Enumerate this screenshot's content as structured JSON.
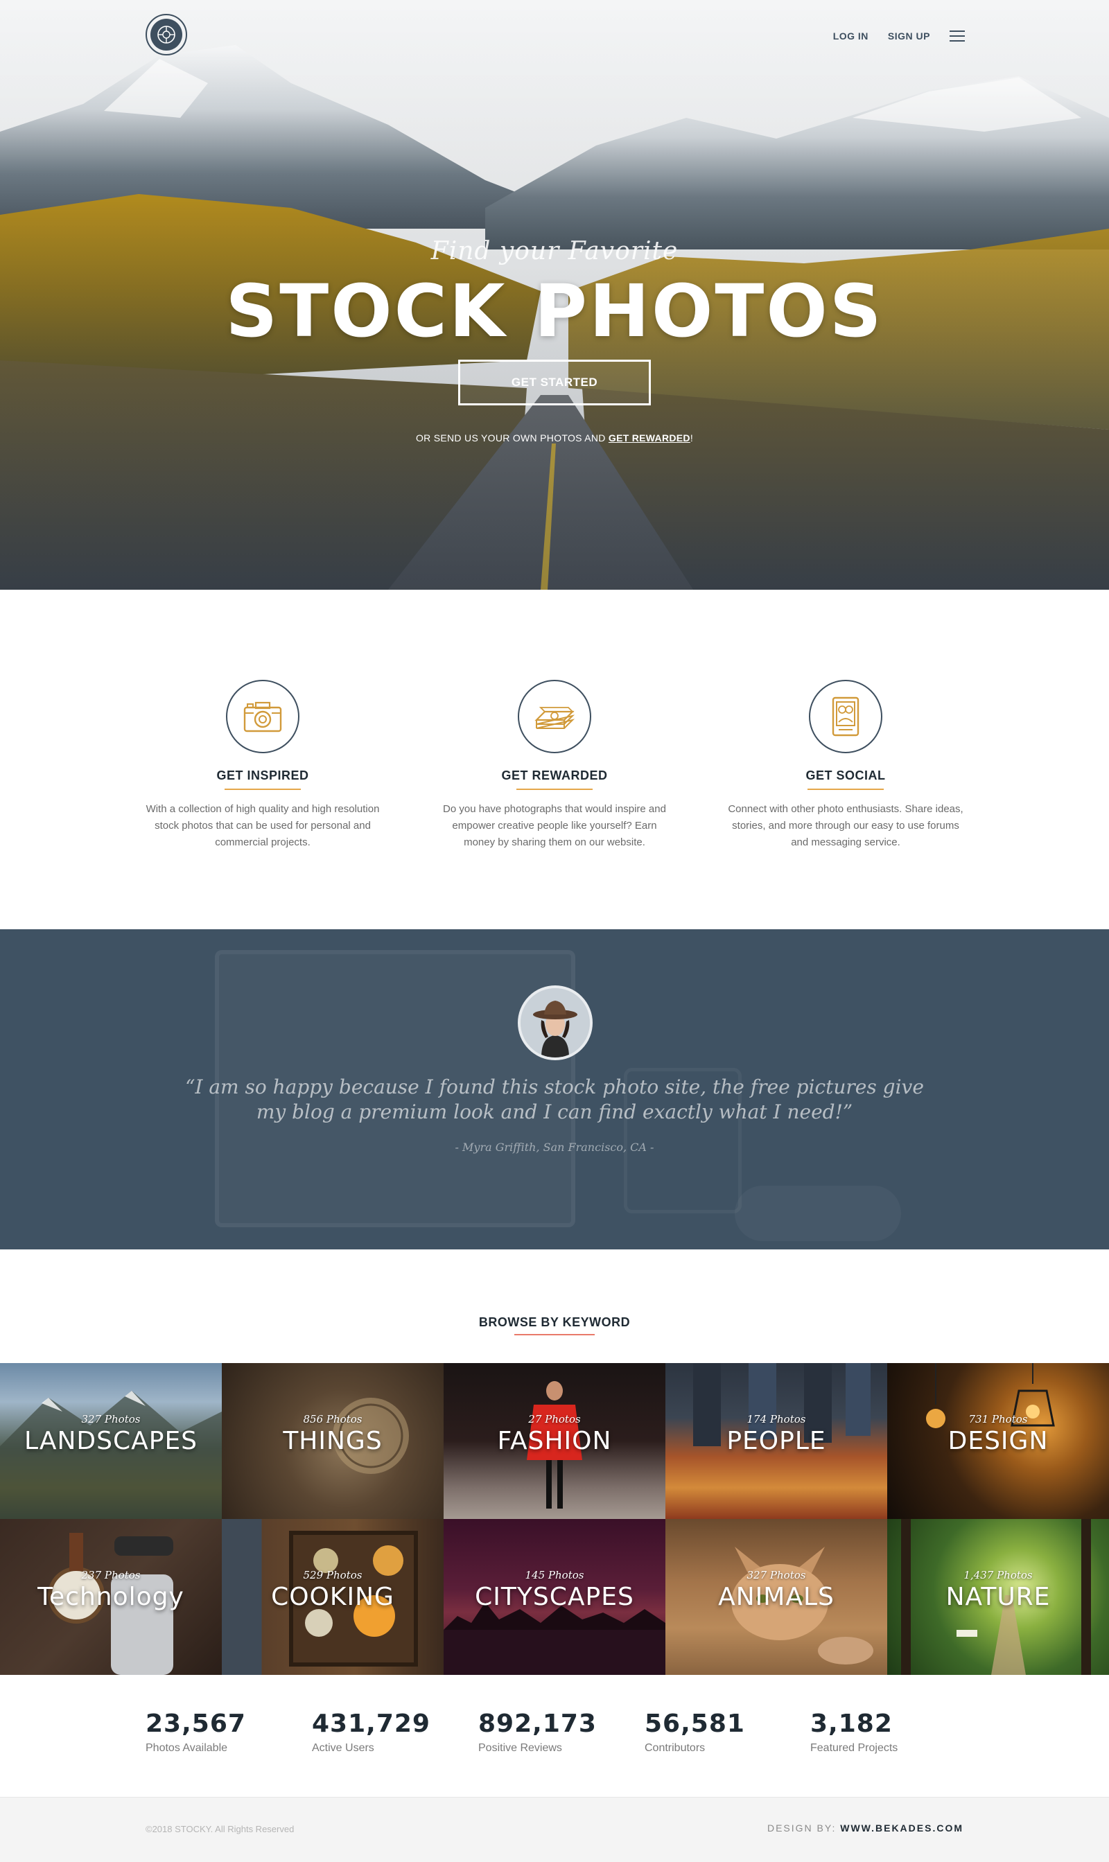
{
  "nav": {
    "login": "LOG IN",
    "signup": "SIGN UP"
  },
  "hero": {
    "subtitle": "Find your Favorite",
    "title": "STOCK PHOTOS",
    "cta": "GET STARTED",
    "note_prefix": "OR SEND US YOUR OWN PHOTOS AND ",
    "note_link": "GET REWARDED",
    "note_suffix": "!"
  },
  "features": [
    {
      "title": "GET INSPIRED",
      "text": "With a collection of high quality and high resolution stock photos that can be used for personal and commercial projects.",
      "icon": "camera-icon"
    },
    {
      "title": "GET REWARDED",
      "text": "Do you have photographs that would inspire and empower creative people like yourself? Earn money by sharing them on our website.",
      "icon": "money-stack-icon"
    },
    {
      "title": "GET SOCIAL",
      "text": "Connect with other photo enthusiasts. Share ideas, stories, and more through our easy to use forums and messaging service.",
      "icon": "social-device-icon"
    }
  ],
  "testimonial": {
    "quote": "“I am so happy because I found this stock photo site,  the free pictures give my blog a premium look and I can find exactly what I need!”",
    "author": "- Myra Griffith, San Francisco, CA -"
  },
  "browse": {
    "heading": "BROWSE BY KEYWORD",
    "tiles": [
      {
        "count": "327 Photos",
        "label": "LANDSCAPES"
      },
      {
        "count": "856 Photos",
        "label": "THINGS"
      },
      {
        "count": "27 Photos",
        "label": "FASHION"
      },
      {
        "count": "174 Photos",
        "label": "PEOPLE"
      },
      {
        "count": "731 Photos",
        "label": "DESIGN"
      },
      {
        "count": "237 Photos",
        "label": "Technology"
      },
      {
        "count": "529 Photos",
        "label": "COOKING"
      },
      {
        "count": "145 Photos",
        "label": "CITYSCAPES"
      },
      {
        "count": "327 Photos",
        "label": "ANIMALS"
      },
      {
        "count": "1,437 Photos",
        "label": "NATURE"
      }
    ]
  },
  "stats": [
    {
      "value": "23,567",
      "label": "Photos Available"
    },
    {
      "value": "431,729",
      "label": "Active Users"
    },
    {
      "value": "892,173",
      "label": "Positive Reviews"
    },
    {
      "value": "56,581",
      "label": "Contributors"
    },
    {
      "value": "3,182",
      "label": "Featured Projects"
    }
  ],
  "footer": {
    "copyright": "©2018 STOCKY. All Rights Reserved",
    "credit_prefix": "DESIGN BY: ",
    "credit_link": "WWW.BEKADES.COM"
  },
  "colors": {
    "navy": "#3e4f5f",
    "accent_gold": "#e5a74a",
    "accent_coral": "#e97a6a",
    "testimonial_bg": "#3f5263"
  }
}
